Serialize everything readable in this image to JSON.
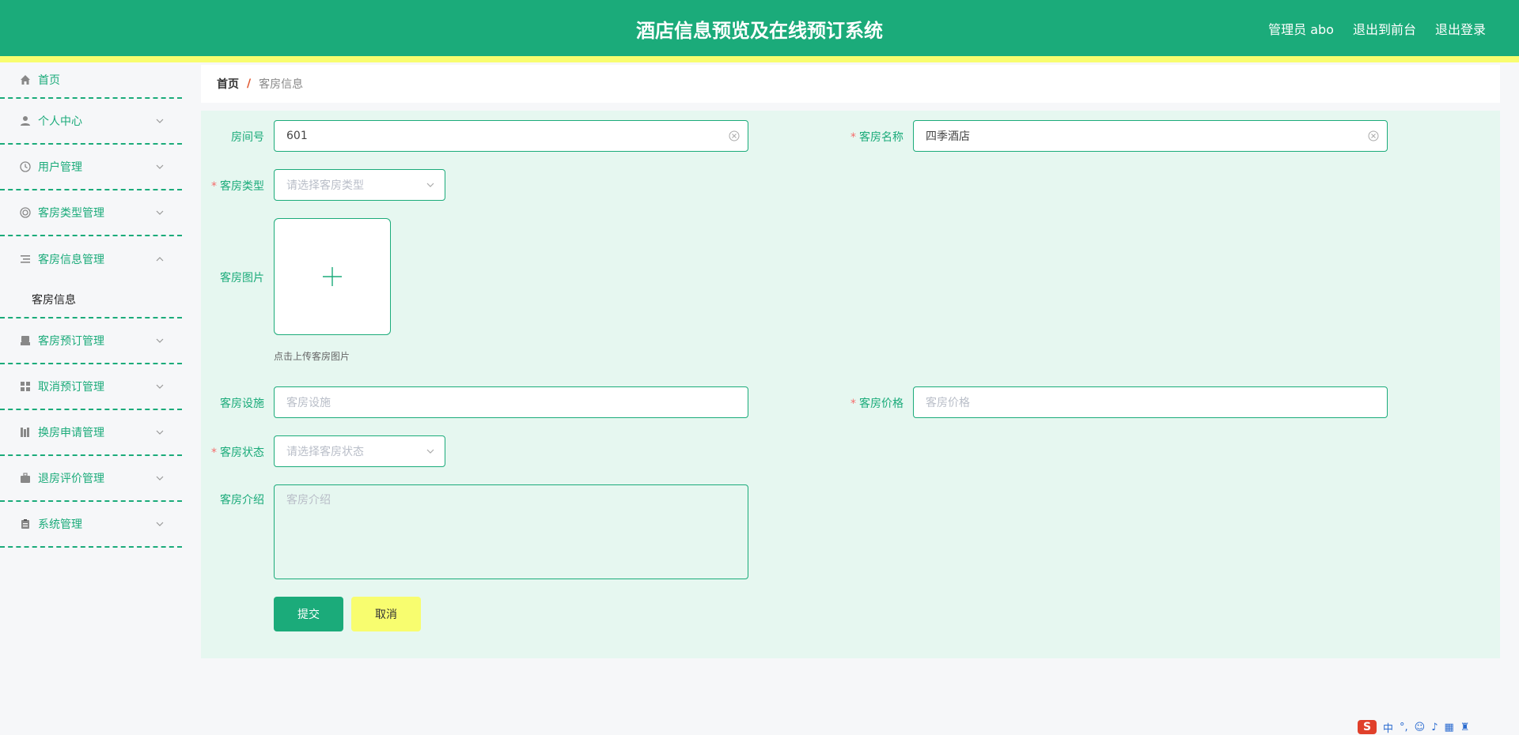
{
  "header": {
    "title": "酒店信息预览及在线预订系统",
    "user": "管理员 abo",
    "to_front": "退出到前台",
    "logout": "退出登录"
  },
  "sidebar": {
    "items": [
      {
        "label": "首页",
        "icon": "home-icon"
      },
      {
        "label": "个人中心",
        "icon": "user-icon"
      },
      {
        "label": "用户管理",
        "icon": "clock-icon"
      },
      {
        "label": "客房类型管理",
        "icon": "ring-icon"
      },
      {
        "label": "客房信息管理",
        "icon": "list-icon"
      },
      {
        "label": "客房预订管理",
        "icon": "printer-icon"
      },
      {
        "label": "取消预订管理",
        "icon": "grid-icon"
      },
      {
        "label": "换房申请管理",
        "icon": "books-icon"
      },
      {
        "label": "退房评价管理",
        "icon": "briefcase-icon"
      },
      {
        "label": "系统管理",
        "icon": "clipboard-icon"
      }
    ],
    "submenu_active": "客房信息"
  },
  "breadcrumb": {
    "home": "首页",
    "separator": "/",
    "current": "客房信息"
  },
  "form": {
    "room_no": {
      "label": "房间号",
      "value": "601"
    },
    "room_name": {
      "label": "客房名称",
      "value": "四季酒店"
    },
    "room_type": {
      "label": "客房类型",
      "placeholder": "请选择客房类型"
    },
    "room_image": {
      "label": "客房图片",
      "tip": "点击上传客房图片"
    },
    "facilities": {
      "label": "客房设施",
      "placeholder": "客房设施"
    },
    "price": {
      "label": "客房价格",
      "placeholder": "客房价格"
    },
    "status": {
      "label": "客房状态",
      "placeholder": "请选择客房状态"
    },
    "intro": {
      "label": "客房介绍",
      "placeholder": "客房介绍"
    },
    "submit": "提交",
    "cancel": "取消"
  },
  "ime": {
    "logo": "S",
    "mode": "中"
  },
  "colors": {
    "primary": "#1bab7a",
    "accent": "#f8fd6f",
    "panel": "#e6f7f0",
    "required": "#f56c6c"
  }
}
